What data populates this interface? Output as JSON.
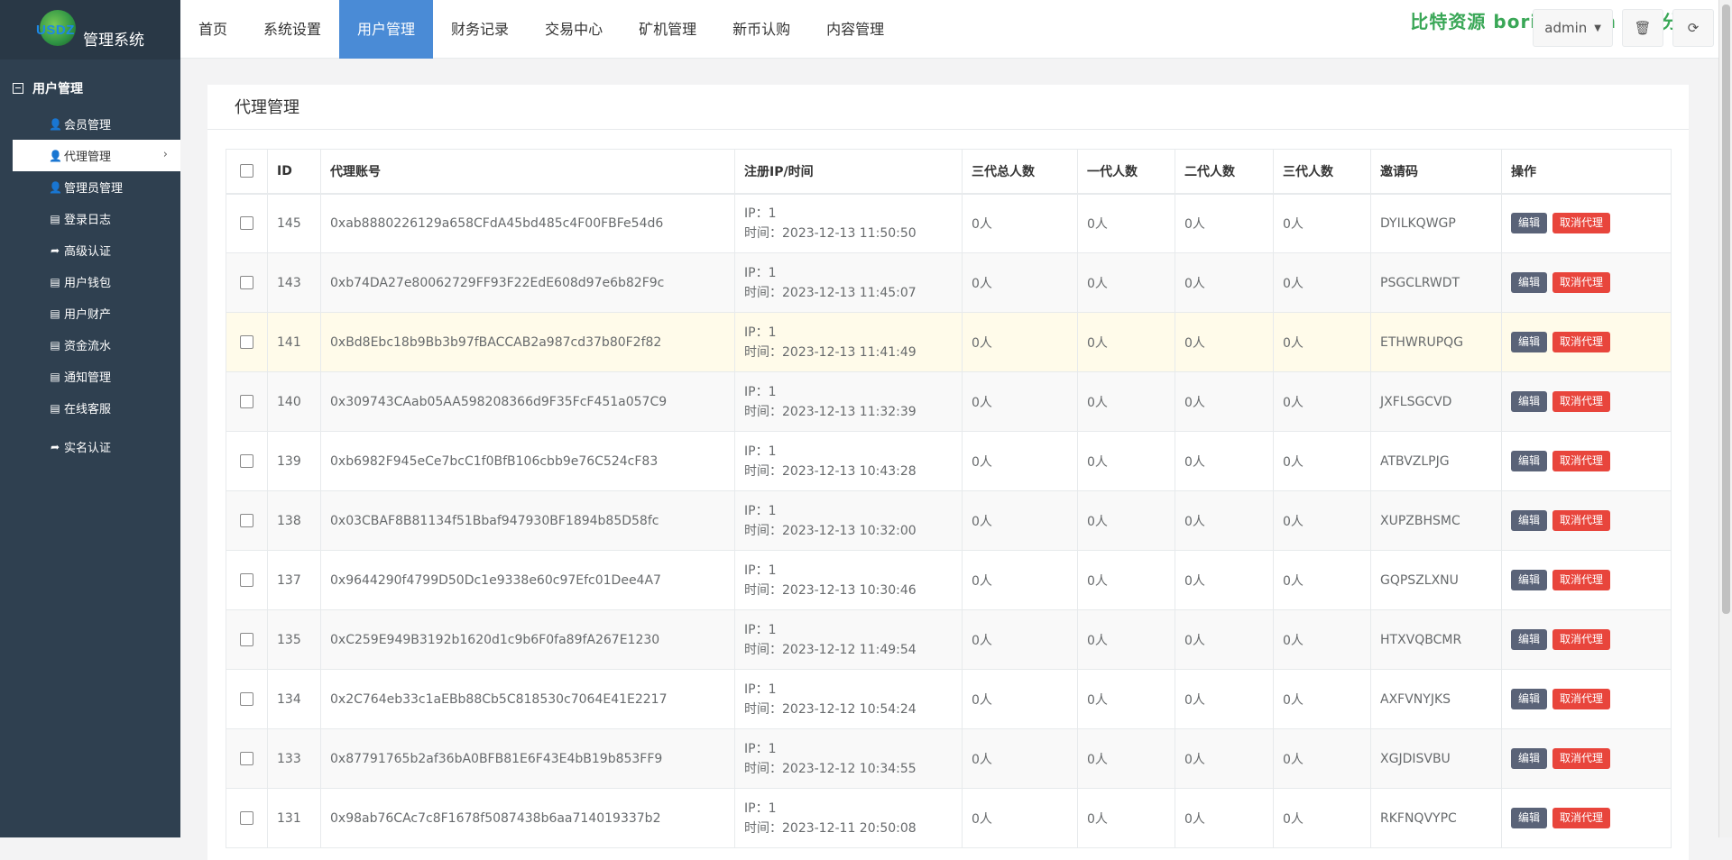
{
  "logo": {
    "mark": "USDZ",
    "title": "管理系统"
  },
  "sidebar": {
    "group_title": "用户管理",
    "items": [
      {
        "label": "会员管理",
        "icon": "user-icon"
      },
      {
        "label": "代理管理",
        "icon": "user-icon",
        "active": true
      },
      {
        "label": "管理员管理",
        "icon": "user-icon"
      },
      {
        "label": "登录日志",
        "icon": "list-icon"
      },
      {
        "label": "高级认证",
        "icon": "share-icon"
      },
      {
        "label": "用户钱包",
        "icon": "list-icon"
      },
      {
        "label": "用户财产",
        "icon": "list-icon"
      },
      {
        "label": "资金流水",
        "icon": "list-icon"
      },
      {
        "label": "通知管理",
        "icon": "list-icon"
      },
      {
        "label": "在线客服",
        "icon": "list-icon"
      },
      {
        "label": "实名认证",
        "icon": "share-icon"
      }
    ]
  },
  "topmenu": {
    "items": [
      "首页",
      "系统设置",
      "用户管理",
      "财务记录",
      "交易中心",
      "矿机管理",
      "新币认购",
      "内容管理"
    ],
    "active_index": 2
  },
  "toolbar": {
    "user": "admin"
  },
  "watermark": "比特资源  bori99.com  实测分享",
  "page": {
    "title": "代理管理"
  },
  "table": {
    "headers": {
      "id": "ID",
      "account": "代理账号",
      "reg": "注册IP/时间",
      "total": "三代总人数",
      "gen1": "一代人数",
      "gen2": "二代人数",
      "gen3": "三代人数",
      "code": "邀请码",
      "ops": "操作"
    },
    "edit_label": "编辑",
    "cancel_label": "取消代理",
    "rows": [
      {
        "id": "145",
        "account": "0xab8880226129a658CFdA45bd485c4F00FBFe54d6",
        "ip": "IP：1",
        "time": "时间：2023-12-13 11:50:50",
        "total": "0人",
        "gen1": "0人",
        "gen2": "0人",
        "gen3": "0人",
        "code": "DYILKQWGP"
      },
      {
        "id": "143",
        "account": "0xb74DA27e80062729FF93F22EdE608d97e6b82F9c",
        "ip": "IP：1",
        "time": "时间：2023-12-13 11:45:07",
        "total": "0人",
        "gen1": "0人",
        "gen2": "0人",
        "gen3": "0人",
        "code": "PSGCLRWDT"
      },
      {
        "id": "141",
        "account": "0xBd8Ebc18b9Bb3b97fBACCAB2a987cd37b80F2f82",
        "ip": "IP：1",
        "time": "时间：2023-12-13 11:41:49",
        "total": "0人",
        "gen1": "0人",
        "gen2": "0人",
        "gen3": "0人",
        "code": "ETHWRUPQG",
        "highlight": true
      },
      {
        "id": "140",
        "account": "0x309743CAab05AA598208366d9F35FcF451a057C9",
        "ip": "IP：1",
        "time": "时间：2023-12-13 11:32:39",
        "total": "0人",
        "gen1": "0人",
        "gen2": "0人",
        "gen3": "0人",
        "code": "JXFLSGCVD"
      },
      {
        "id": "139",
        "account": "0xb6982F945eCe7bcC1f0BfB106cbb9e76C524cF83",
        "ip": "IP：1",
        "time": "时间：2023-12-13 10:43:28",
        "total": "0人",
        "gen1": "0人",
        "gen2": "0人",
        "gen3": "0人",
        "code": "ATBVZLPJG"
      },
      {
        "id": "138",
        "account": "0x03CBAF8B81134f51Bbaf947930BF1894b85D58fc",
        "ip": "IP：1",
        "time": "时间：2023-12-13 10:32:00",
        "total": "0人",
        "gen1": "0人",
        "gen2": "0人",
        "gen3": "0人",
        "code": "XUPZBHSMC"
      },
      {
        "id": "137",
        "account": "0x9644290f4799D50Dc1e9338e60c97Efc01Dee4A7",
        "ip": "IP：1",
        "time": "时间：2023-12-13 10:30:46",
        "total": "0人",
        "gen1": "0人",
        "gen2": "0人",
        "gen3": "0人",
        "code": "GQPSZLXNU"
      },
      {
        "id": "135",
        "account": "0xC259E949B3192b1620d1c9b6F0fa89fA267E1230",
        "ip": "IP：1",
        "time": "时间：2023-12-12 11:49:54",
        "total": "0人",
        "gen1": "0人",
        "gen2": "0人",
        "gen3": "0人",
        "code": "HTXVQBCMR"
      },
      {
        "id": "134",
        "account": "0x2C764eb33c1aEBb88Cb5C818530c7064E41E2217",
        "ip": "IP：1",
        "time": "时间：2023-12-12 10:54:24",
        "total": "0人",
        "gen1": "0人",
        "gen2": "0人",
        "gen3": "0人",
        "code": "AXFVNYJKS"
      },
      {
        "id": "133",
        "account": "0x87791765b2af36bA0BFB81E6F43E4bB19b853FF9",
        "ip": "IP：1",
        "time": "时间：2023-12-12 10:34:55",
        "total": "0人",
        "gen1": "0人",
        "gen2": "0人",
        "gen3": "0人",
        "code": "XGJDISVBU"
      },
      {
        "id": "131",
        "account": "0x98ab76CAc7c8F1678f5087438b6aa714019337b2",
        "ip": "IP：1",
        "time": "时间：2023-12-11 20:50:08",
        "total": "0人",
        "gen1": "0人",
        "gen2": "0人",
        "gen3": "0人",
        "code": "RKFNQVYPC"
      }
    ]
  }
}
